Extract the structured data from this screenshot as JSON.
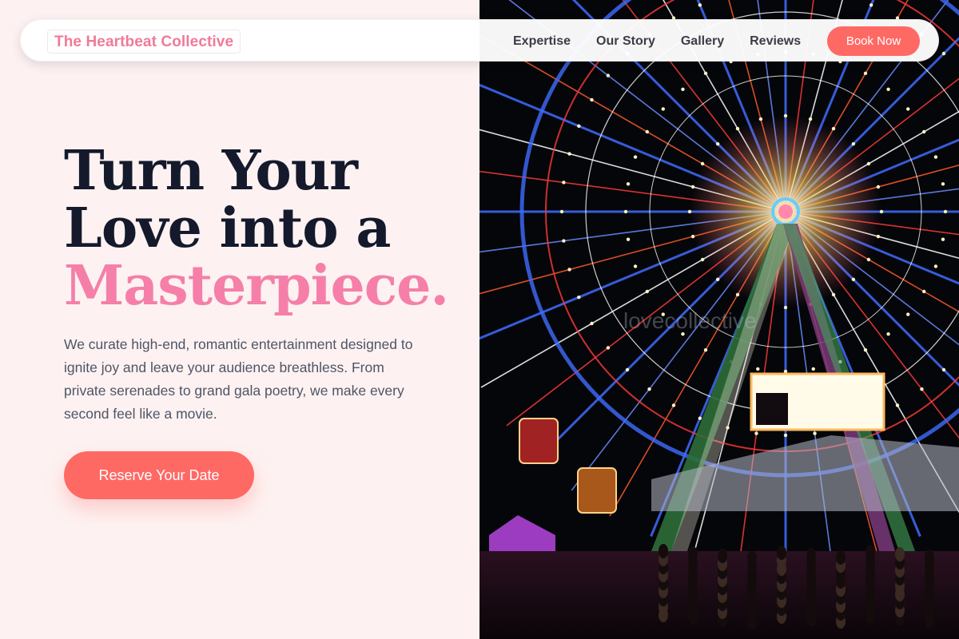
{
  "nav": {
    "brand": "The Heartbeat Collective",
    "links": [
      "Expertise",
      "Our Story",
      "Gallery",
      "Reviews"
    ],
    "cta": "Book Now"
  },
  "hero": {
    "headline_line1": "Turn Your",
    "headline_line2": "Love into a",
    "headline_accent": "Masterpiece.",
    "intro": "We curate high-end, romantic entertainment designed to ignite joy and leave your audience breathless. From private serenades to grand gala poetry, we make every second feel like a movie.",
    "cta": "Reserve Your Date"
  },
  "image": {
    "watermark": "lovecollective"
  },
  "colors": {
    "accent": "#ff6964",
    "brand": "#f07a98",
    "headline_accent": "#f57fa9",
    "headline": "#141a2c",
    "background": "#fdf2f1"
  }
}
